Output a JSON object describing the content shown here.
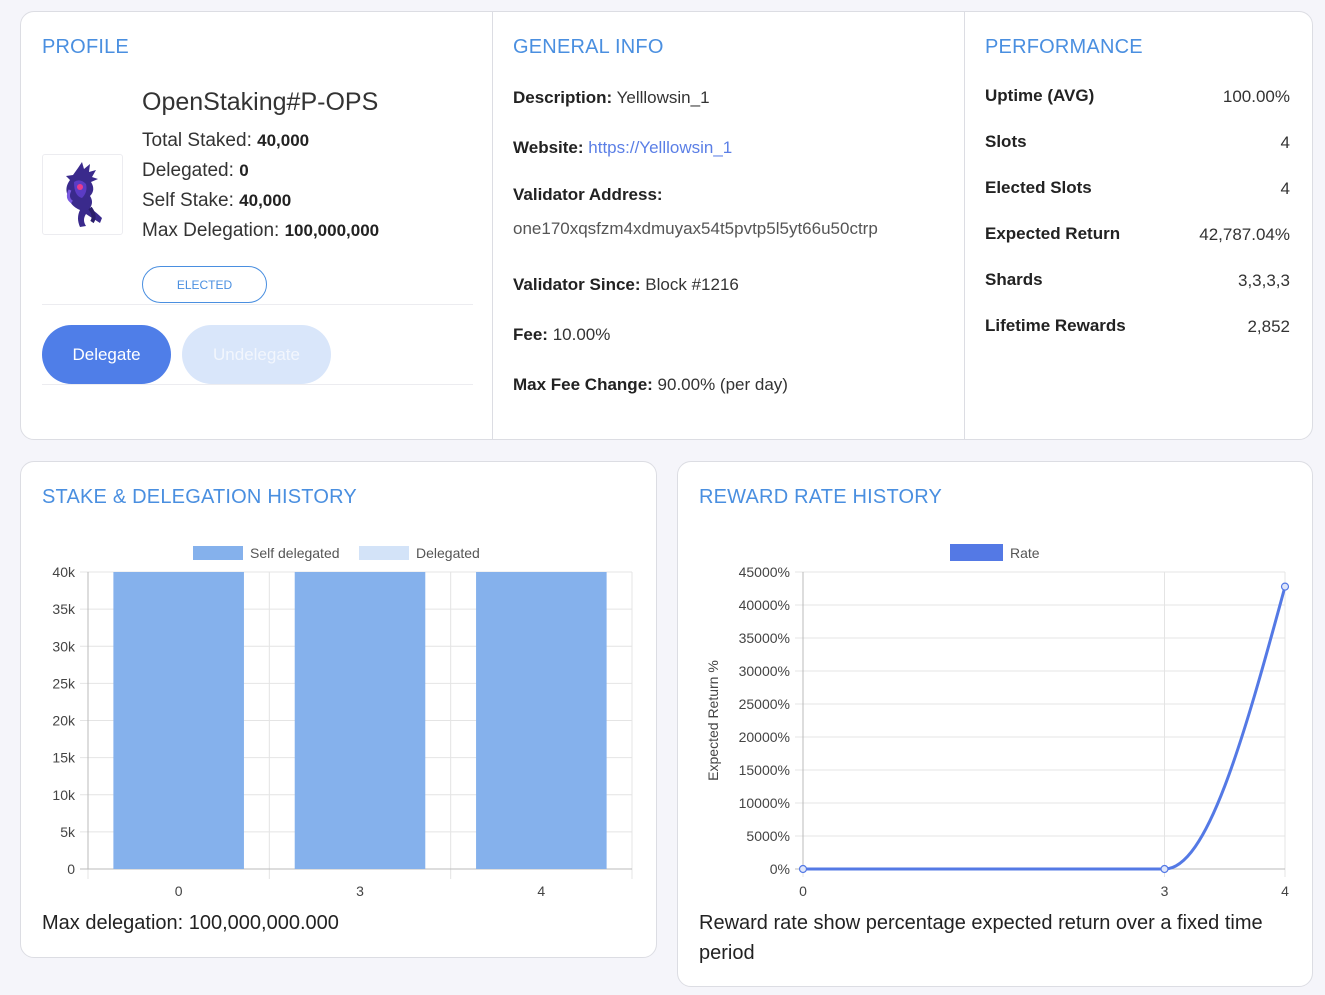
{
  "profile": {
    "title": "PROFILE",
    "name": "OpenStaking#P-OPS",
    "total_staked_label": "Total Staked:",
    "total_staked": "40,000",
    "delegated_label": "Delegated:",
    "delegated": "0",
    "self_stake_label": "Self Stake:",
    "self_stake": "40,000",
    "max_delegation_label": "Max Delegation:",
    "max_delegation": "100,000,000",
    "status": "ELECTED",
    "delegate_label": "Delegate",
    "undelegate_label": "Undelegate"
  },
  "general": {
    "title": "GENERAL INFO",
    "description_label": "Description:",
    "description": "Yelllowsin_1",
    "website_label": "Website:",
    "website": "https://Yelllowsin_1",
    "address_label": "Validator Address:",
    "address": "one170xqsfzm4xdmuyax54t5pvtp5l5yt66u50ctrp",
    "since_label": "Validator Since:",
    "since": "Block #1216",
    "fee_label": "Fee:",
    "fee": "10.00%",
    "max_fee_change_label": "Max Fee Change:",
    "max_fee_change": "90.00% (per day)"
  },
  "performance": {
    "title": "PERFORMANCE",
    "rows": [
      {
        "label": "Uptime (AVG)",
        "value": "100.00%"
      },
      {
        "label": "Slots",
        "value": "4"
      },
      {
        "label": "Elected Slots",
        "value": "4"
      },
      {
        "label": "Expected Return",
        "value": "42,787.04%"
      },
      {
        "label": "Shards",
        "value": "3,3,3,3"
      },
      {
        "label": "Lifetime Rewards",
        "value": "2,852"
      }
    ]
  },
  "stake_history": {
    "title": "STAKE & DELEGATION HISTORY",
    "caption": "Max delegation: 100,000,000.000"
  },
  "reward_history": {
    "title": "REWARD RATE HISTORY",
    "caption": "Reward rate show percentage expected return over a fixed time period"
  },
  "chart_data": [
    {
      "type": "bar",
      "stacked": true,
      "categories": [
        "0",
        "3",
        "4"
      ],
      "series": [
        {
          "name": "Self delegated",
          "values": [
            40000,
            40000,
            40000
          ],
          "color": "#85b1ec"
        },
        {
          "name": "Delegated",
          "values": [
            0,
            0,
            0
          ],
          "color": "#d3e3f8"
        }
      ],
      "yticks": [
        "0",
        "5k",
        "10k",
        "15k",
        "20k",
        "25k",
        "30k",
        "35k",
        "40k"
      ],
      "ylim": [
        0,
        40000
      ],
      "grid": true,
      "legend": "top"
    },
    {
      "type": "line",
      "x": [
        0,
        3,
        4
      ],
      "xlabels": [
        "0",
        "3",
        "4"
      ],
      "series": [
        {
          "name": "Rate",
          "values": [
            0,
            0,
            42787.04
          ],
          "color": "#5479e5"
        }
      ],
      "ylabel": "Expected Return %",
      "yticks": [
        "0%",
        "5000%",
        "10000%",
        "15000%",
        "20000%",
        "25000%",
        "30000%",
        "35000%",
        "40000%",
        "45000%"
      ],
      "ylim": [
        0,
        45000
      ],
      "grid": true,
      "legend": "top"
    }
  ]
}
